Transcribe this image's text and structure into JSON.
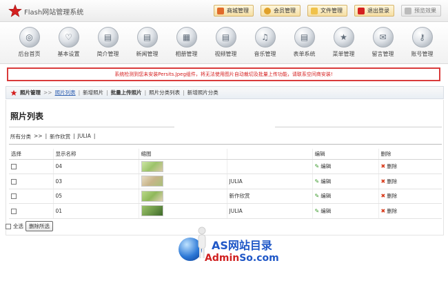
{
  "app": {
    "title": "Flash网站管理系统"
  },
  "top_buttons": [
    {
      "label": "商城管理",
      "icon": "store-icon"
    },
    {
      "label": "会员管理",
      "icon": "members-icon"
    },
    {
      "label": "文件管理",
      "icon": "files-icon"
    },
    {
      "label": "退出登录",
      "icon": "logout-icon"
    },
    {
      "label": "预览效果",
      "icon": "preview-icon"
    }
  ],
  "nav": [
    {
      "label": "后台首页",
      "glyph": "◎"
    },
    {
      "label": "基本设置",
      "glyph": "♡"
    },
    {
      "label": "简介管理",
      "glyph": "▤"
    },
    {
      "label": "新闻管理",
      "glyph": "▤"
    },
    {
      "label": "相册管理",
      "glyph": "▦"
    },
    {
      "label": "视频管理",
      "glyph": "▤"
    },
    {
      "label": "音乐管理",
      "glyph": "♫"
    },
    {
      "label": "表单系统",
      "glyph": "▤"
    },
    {
      "label": "菜单管理",
      "glyph": "★"
    },
    {
      "label": "留言管理",
      "glyph": "✉"
    },
    {
      "label": "账号管理",
      "glyph": "⚷"
    }
  ],
  "warning": "系统检测到您未安装Persits.Jpeg组件，将无法使用图片自动裁切及批量上传功能，请联系空间商安装!",
  "breadcrumb": {
    "title": "照片管理",
    "arrow": ">>",
    "current": "照片列表",
    "items": [
      "新增照片",
      "批量上传照片",
      "照片分类列表",
      "新增照片分类"
    ]
  },
  "page_title": "照片列表",
  "filter": {
    "all": "所有分类",
    "arrow": ">>",
    "sep": "|",
    "items": [
      "新作欣赏",
      "JULIA"
    ]
  },
  "table": {
    "headers": {
      "select": "选择",
      "name": "显示名称",
      "thumb": "缩图",
      "category": "",
      "edit": "编辑",
      "delete": "删除"
    },
    "rows": [
      {
        "name": "04",
        "category": "",
        "edit": "编辑",
        "delete": "删除",
        "thumb_color": "#9cc36a"
      },
      {
        "name": "03",
        "category": "JULIA",
        "edit": "编辑",
        "delete": "删除",
        "thumb_color": "#c7b48a"
      },
      {
        "name": "05",
        "category": "新作欣赏",
        "edit": "编辑",
        "delete": "删除",
        "thumb_color": "#8fb85a"
      },
      {
        "name": "01",
        "category": "JULIA",
        "edit": "编辑",
        "delete": "删除",
        "thumb_color": "#6f9a4a"
      }
    ]
  },
  "footer": {
    "select_all": "全选",
    "delete_selected": "删除所选"
  },
  "watermark": {
    "line1": "AS网站目录",
    "line2a": "Admin",
    "line2b": "So.com"
  },
  "colors": {
    "warning": "#d93a3a",
    "link": "#2b5db0",
    "logo_red": "#d42020"
  }
}
